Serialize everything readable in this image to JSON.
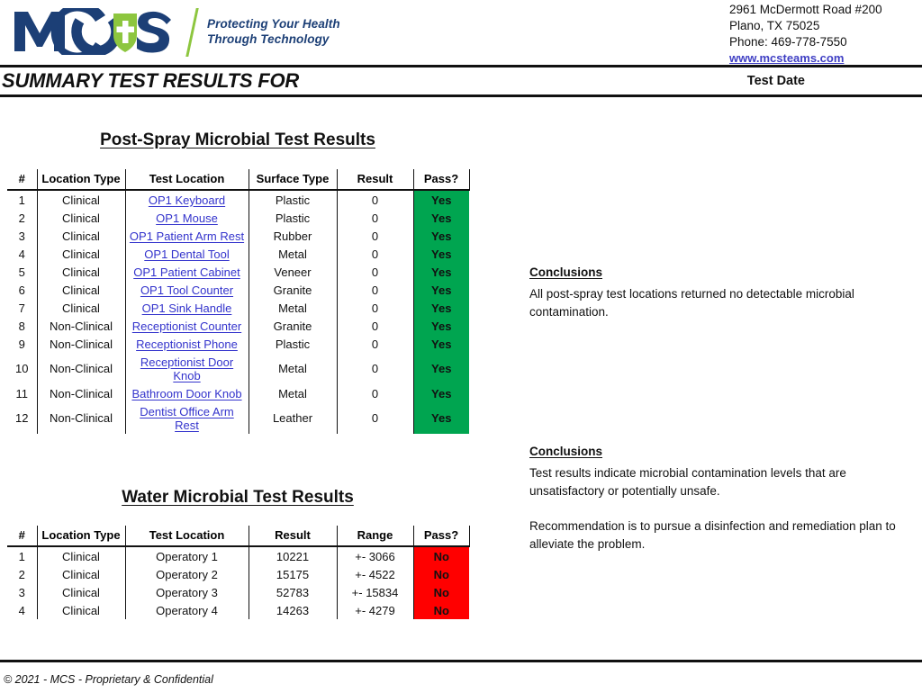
{
  "brand": {
    "logo_text_left": "MC",
    "logo_text_right": "S",
    "logo_icon": "shield-plus-icon",
    "tagline_line1": "Protecting Your Health",
    "tagline_line2": "Through Technology",
    "navy": "#1C3F76",
    "green": "#8DC63F"
  },
  "contact": {
    "address_line1": "2961 McDermott Road  #200",
    "address_line2": "Plano, TX  75025",
    "phone": "Phone: 469-778-7550",
    "website": "www.mcsteams.com"
  },
  "header": {
    "title": "SUMMARY TEST RESULTS FOR",
    "test_date_label": "Test Date"
  },
  "post_spray": {
    "title": "Post-Spray Microbial Test Results",
    "columns": [
      "#",
      "Location Type",
      "Test Location",
      "Surface Type",
      "Result",
      "Pass?"
    ],
    "rows": [
      {
        "num": "1",
        "location_type": "Clinical",
        "test_location": "OP1 Keyboard",
        "surface_type": "Plastic",
        "result": "0",
        "pass": "Yes"
      },
      {
        "num": "2",
        "location_type": "Clinical",
        "test_location": "OP1 Mouse",
        "surface_type": "Plastic",
        "result": "0",
        "pass": "Yes"
      },
      {
        "num": "3",
        "location_type": "Clinical",
        "test_location": "OP1 Patient Arm Rest",
        "surface_type": "Rubber",
        "result": "0",
        "pass": "Yes"
      },
      {
        "num": "4",
        "location_type": "Clinical",
        "test_location": "OP1 Dental Tool",
        "surface_type": "Metal",
        "result": "0",
        "pass": "Yes"
      },
      {
        "num": "5",
        "location_type": "Clinical",
        "test_location": "OP1 Patient Cabinet",
        "surface_type": "Veneer",
        "result": "0",
        "pass": "Yes"
      },
      {
        "num": "6",
        "location_type": "Clinical",
        "test_location": "OP1 Tool Counter",
        "surface_type": "Granite",
        "result": "0",
        "pass": "Yes"
      },
      {
        "num": "7",
        "location_type": "Clinical",
        "test_location": "OP1 Sink Handle",
        "surface_type": "Metal",
        "result": "0",
        "pass": "Yes"
      },
      {
        "num": "8",
        "location_type": "Non-Clinical",
        "test_location": "Receptionist Counter",
        "surface_type": "Granite",
        "result": "0",
        "pass": "Yes"
      },
      {
        "num": "9",
        "location_type": "Non-Clinical",
        "test_location": "Receptionist Phone",
        "surface_type": "Plastic",
        "result": "0",
        "pass": "Yes"
      },
      {
        "num": "10",
        "location_type": "Non-Clinical",
        "test_location": "Receptionist Door Knob",
        "surface_type": "Metal",
        "result": "0",
        "pass": "Yes"
      },
      {
        "num": "11",
        "location_type": "Non-Clinical",
        "test_location": "Bathroom Door Knob",
        "surface_type": "Metal",
        "result": "0",
        "pass": "Yes"
      },
      {
        "num": "12",
        "location_type": "Non-Clinical",
        "test_location": "Dentist Office Arm Rest",
        "surface_type": "Leather",
        "result": "0",
        "pass": "Yes"
      }
    ],
    "conclusions_heading": "Conclusions",
    "conclusions_paragraphs": [
      "All post-spray test locations returned no detectable microbial contamination."
    ],
    "pass_color": "#00A550"
  },
  "water": {
    "title": "Water Microbial Test Results",
    "columns": [
      "#",
      "Location Type",
      "Test Location",
      "Result",
      "Range",
      "Pass?"
    ],
    "rows": [
      {
        "num": "1",
        "location_type": "Clinical",
        "test_location": "Operatory 1",
        "result": "10221",
        "range": "+- 3066",
        "pass": "No"
      },
      {
        "num": "2",
        "location_type": "Clinical",
        "test_location": "Operatory 2",
        "result": "15175",
        "range": "+- 4522",
        "pass": "No"
      },
      {
        "num": "3",
        "location_type": "Clinical",
        "test_location": "Operatory 3",
        "result": "52783",
        "range": "+- 15834",
        "pass": "No"
      },
      {
        "num": "4",
        "location_type": "Clinical",
        "test_location": "Operatory 4",
        "result": "14263",
        "range": "+- 4279",
        "pass": "No"
      }
    ],
    "conclusions_heading": "Conclusions",
    "conclusions_paragraphs": [
      "Test results indicate microbial contamination levels that are unsatisfactory or potentially unsafe.",
      "Recommendation is to pursue a disinfection and remediation plan to alleviate the problem."
    ],
    "fail_color": "#FF0000"
  },
  "footer": {
    "copyright": "© 2021 - MCS - Proprietary & Confidential"
  }
}
